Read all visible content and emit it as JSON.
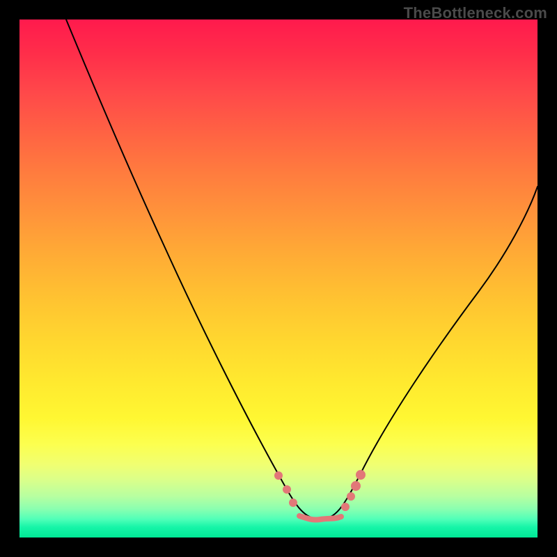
{
  "watermark": "TheBottleneck.com",
  "colors": {
    "background": "#000000",
    "gradient_top": "#ff1a4d",
    "gradient_bottom": "#00e896",
    "curve": "#000000",
    "markers": "#e27878",
    "watermark_text": "#4a4a4a"
  },
  "chart_data": {
    "type": "line",
    "title": "",
    "xlabel": "",
    "ylabel": "",
    "xlim": [
      0,
      100
    ],
    "ylim": [
      0,
      100
    ],
    "grid": false,
    "legend": false,
    "series": [
      {
        "name": "curve",
        "x": [
          9,
          14,
          20,
          26,
          32,
          38,
          44,
          48,
          51,
          54,
          57,
          60,
          63,
          67,
          72,
          78,
          85,
          92,
          100
        ],
        "y": [
          100,
          89,
          78,
          66,
          54,
          42,
          29,
          18,
          10,
          5,
          3,
          3,
          5,
          10,
          18,
          29,
          42,
          55,
          68
        ]
      }
    ],
    "annotations": [
      {
        "type": "marker",
        "shape": "dot",
        "x": 50,
        "y": 12
      },
      {
        "type": "marker",
        "shape": "dot",
        "x": 52,
        "y": 9
      },
      {
        "type": "marker",
        "shape": "dot",
        "x": 53,
        "y": 6
      },
      {
        "type": "marker",
        "shape": "line",
        "x0": 54,
        "y0": 3.5,
        "x1": 62,
        "y1": 3.5
      },
      {
        "type": "marker",
        "shape": "dot",
        "x": 63,
        "y": 5
      },
      {
        "type": "marker",
        "shape": "dot",
        "x": 64,
        "y": 7
      },
      {
        "type": "marker",
        "shape": "dot",
        "x": 65,
        "y": 9
      },
      {
        "type": "marker",
        "shape": "dot",
        "x": 66,
        "y": 11
      }
    ]
  }
}
